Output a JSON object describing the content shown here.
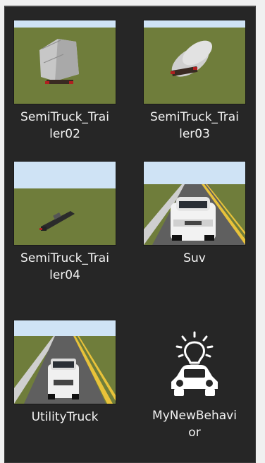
{
  "assets": [
    {
      "label": "SemiTruck_Trailer02",
      "thumb": "semi-trailer-box-icon"
    },
    {
      "label": "SemiTruck_Trailer03",
      "thumb": "semi-trailer-tanker-icon"
    },
    {
      "label": "SemiTruck_Trailer04",
      "thumb": "semi-trailer-flatbed-icon"
    },
    {
      "label": "Suv",
      "thumb": "suv-road-icon"
    },
    {
      "label": "UtilityTruck",
      "thumb": "utility-truck-road-icon"
    },
    {
      "label": "MyNewBehavior",
      "thumb": "car-lightbulb-behavior-icon"
    }
  ],
  "colors": {
    "panel": "#262626",
    "sky": "#cfe3f5",
    "grass": "#6f7d3b",
    "road": "#5f5f5f",
    "lane": "#e8c23a",
    "text": "#f2f2f2"
  }
}
